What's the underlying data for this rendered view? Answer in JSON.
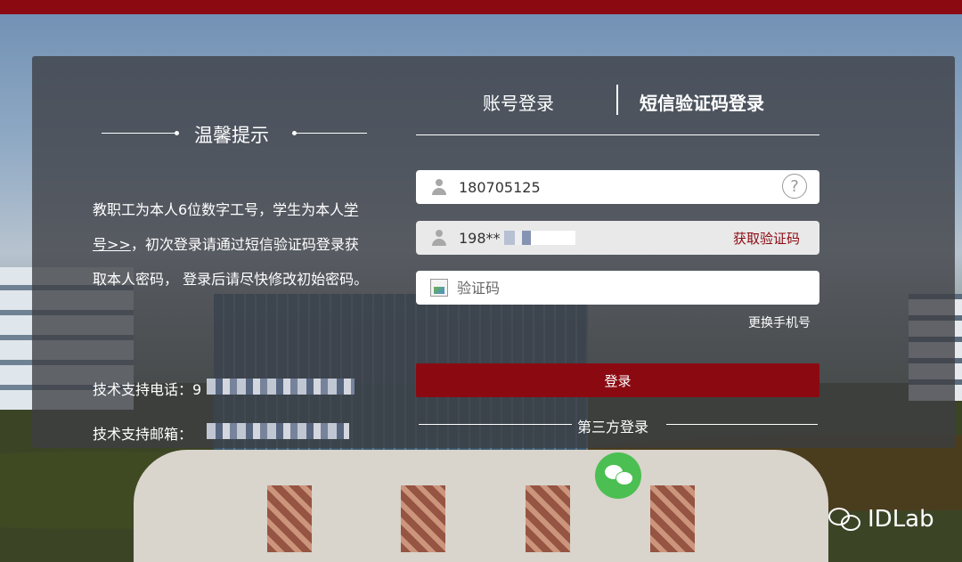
{
  "tabs": {
    "account_login": "账号登录",
    "sms_login": "短信验证码登录"
  },
  "tips": {
    "title": "温馨提示",
    "text_before_link": "教职工为本人6位数字工号，学生为本人",
    "link": "学号>>",
    "text_after_link": "，初次登录请通过短信验证码登录获取本人密码， 登录后请尽快修改初始密码。",
    "phone_label": "技术支持电话：",
    "phone_value": "9",
    "email_label": "技术支持邮箱："
  },
  "form": {
    "account_value": "180705125",
    "help_symbol": "?",
    "phone_value": "198**",
    "get_code_label": "获取验证码",
    "captcha_placeholder": "验证码",
    "change_phone_label": "更换手机号",
    "login_label": "登录",
    "third_party_label": "第三方登录"
  },
  "watermark": "IDLab",
  "colors": {
    "brand": "#8b0a12",
    "wechat": "#4bbf52"
  }
}
